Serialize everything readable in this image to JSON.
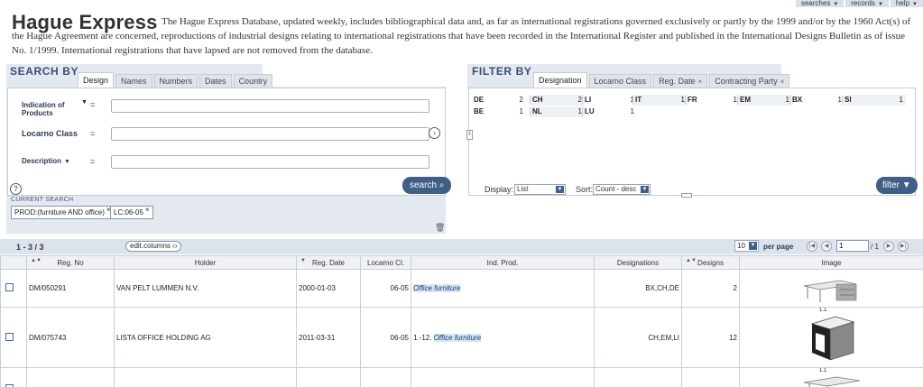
{
  "topnav": [
    {
      "label": "searches"
    },
    {
      "label": "records"
    },
    {
      "label": "help"
    }
  ],
  "header": {
    "title": "Hague Express",
    "description": "The Hague Express Database, updated weekly, includes bibliographical data and, as far as international registrations governed exclusively or partly by the 1999 and/or by the 1960 Act(s) of the Hague Agreement are concerned, reproductions of industrial designs relating to international registrations that have been recorded in the International Register and published in the International Designs Bulletin as of issue No. 1/1999. International registrations that have lapsed are not removed from the database."
  },
  "search": {
    "heading": "SEARCH BY",
    "tabs": [
      "Design",
      "Names",
      "Numbers",
      "Dates",
      "Country"
    ],
    "fields": [
      {
        "label": "Indication of Products",
        "eq": "=",
        "value": ""
      },
      {
        "label": "Locarno Class",
        "eq": "=",
        "value": ""
      },
      {
        "label": "Description",
        "eq": "=",
        "value": ""
      }
    ],
    "help": "?",
    "button": "search",
    "current_label": "CURRENT SEARCH",
    "chips": [
      "PROD:(furniture AND office)",
      "LC:06-05"
    ]
  },
  "filter": {
    "heading": "FILTER BY",
    "tabs": [
      "Designation",
      "Locarno Class",
      "Reg. Date",
      "Contracting Party"
    ],
    "row1": [
      {
        "code": "DE",
        "count": "2"
      },
      {
        "code": "CH",
        "count": "2"
      },
      {
        "code": "LI",
        "count": "1"
      },
      {
        "code": "IT",
        "count": "1"
      },
      {
        "code": "FR",
        "count": "1"
      },
      {
        "code": "EM",
        "count": "1"
      },
      {
        "code": "BX",
        "count": "1"
      },
      {
        "code": "SI",
        "count": "1"
      }
    ],
    "row2": [
      {
        "code": "BE",
        "count": "1"
      },
      {
        "code": "NL",
        "count": "1"
      },
      {
        "code": "LU",
        "count": "1"
      }
    ],
    "display_label": "Display:",
    "display_value": "List",
    "sort_label": "Sort:",
    "sort_value": "Count - desc",
    "button": "filter"
  },
  "results": {
    "count": "1 - 3 / 3",
    "edit_columns": "edit.columns",
    "per_page_value": "10",
    "per_page_label": "per page",
    "page_value": "1",
    "page_total": "/ 1",
    "columns": [
      "Reg. No",
      "Holder",
      "Reg. Date",
      "Locarno Cl.",
      "Ind. Prod.",
      "Designations",
      "Designs",
      "Image"
    ],
    "rows": [
      {
        "reg_no": "DM/050291",
        "holder": "VAN PELT LUMMEN N.V.",
        "reg_date": "2000-01-03",
        "locarno": "06-05",
        "prod_prefix": "",
        "prod": "Office furniture",
        "designations": "BX,CH,DE",
        "designs": "2",
        "image_caption": ""
      },
      {
        "reg_no": "DM/075743",
        "holder": "LISTA OFFICE HOLDING AG",
        "reg_date": "2011-03-31",
        "locarno": "06-05",
        "prod_prefix": "1.-12.",
        "prod": "Office furniture",
        "designations": "CH,EM,LI",
        "designs": "12",
        "image_caption": "1.1"
      },
      {
        "reg_no": "",
        "holder": "",
        "reg_date": "",
        "locarno": "",
        "prod_prefix": "",
        "prod": "",
        "designations": "",
        "designs": "",
        "image_caption": "1.1"
      }
    ]
  }
}
